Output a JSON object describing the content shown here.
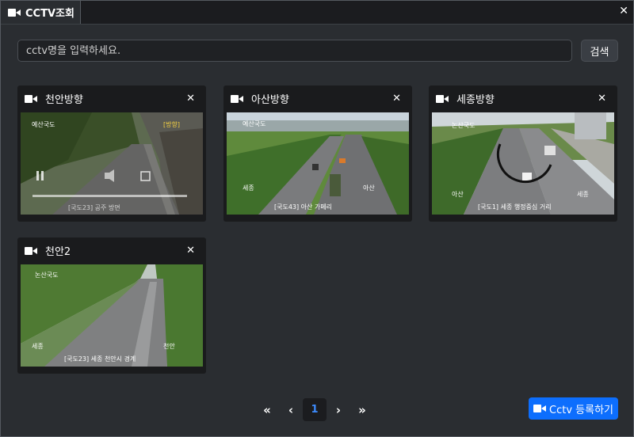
{
  "window": {
    "tab_title": "CCTV조회",
    "close_icon": "✕"
  },
  "search": {
    "placeholder": "cctv명을 입력하세요.",
    "button_label": "검색"
  },
  "cards": [
    {
      "title": "천안방향",
      "overlay": {
        "top_left": "예산국도",
        "top_right": "[방향]",
        "bottom": "[국도23] 공주 방면"
      }
    },
    {
      "title": "아산방향",
      "overlay": {
        "top_left": "예산국도",
        "left": "세종",
        "right": "아산",
        "bottom": "[국도43] 아산 가페리"
      }
    },
    {
      "title": "세종방향",
      "overlay": {
        "top_left": "논산국도",
        "left": "아산",
        "right": "세종",
        "bottom": "[국도1] 세종 행정중심 거리"
      }
    },
    {
      "title": "천안2",
      "overlay": {
        "top_left": "논산국도",
        "left": "세종",
        "right": "천안",
        "bottom": "[국도23] 세종 천안시 경계"
      }
    }
  ],
  "pagination": {
    "first": "«",
    "prev": "‹",
    "current": "1",
    "next": "›",
    "last": "»"
  },
  "register": {
    "label": "Cctv 등록하기"
  },
  "colors": {
    "accent": "#0d6efd",
    "background": "#2a2d31",
    "card": "#1a1b1d"
  }
}
